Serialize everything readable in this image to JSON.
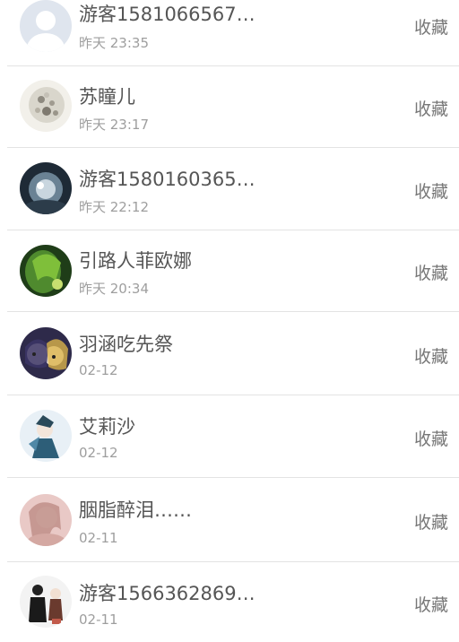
{
  "feed": {
    "items": [
      {
        "name": "游客1581066567…",
        "time": "昨天 23:35",
        "action": "收藏"
      },
      {
        "name": "苏瞳儿",
        "time": "昨天 23:17",
        "action": "收藏"
      },
      {
        "name": "游客1580160365…",
        "time": "昨天 22:12",
        "action": "收藏"
      },
      {
        "name": "引路人菲欧娜",
        "time": "昨天 20:34",
        "action": "收藏"
      },
      {
        "name": "羽涵吃先祭",
        "time": "02-12",
        "action": "收藏"
      },
      {
        "name": "艾莉沙",
        "time": "02-12",
        "action": "收藏"
      },
      {
        "name": "胭脂醉泪……",
        "time": "02-11",
        "action": "收藏"
      },
      {
        "name": "游客1566362869…",
        "time": "02-11",
        "action": "收藏"
      }
    ]
  },
  "icons": {
    "default_avatar": "user-silhouette-icon"
  },
  "colors": {
    "name_text": "#555555",
    "time_text": "#9e9e9e",
    "action_text": "#777777",
    "divider": "#e3e3e3"
  }
}
